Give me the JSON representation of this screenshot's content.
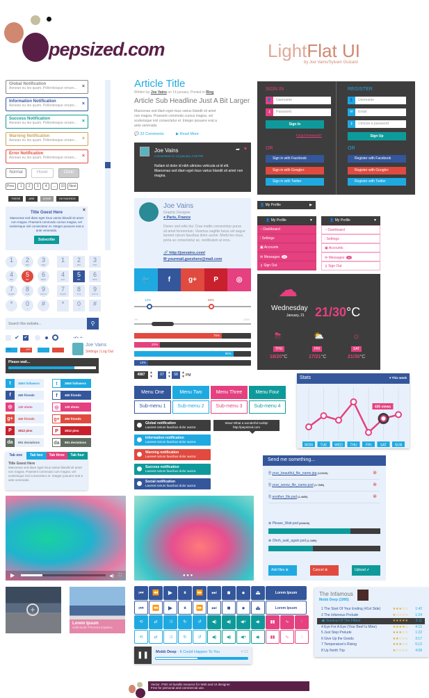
{
  "brand": {
    "logo": "pepsized.com",
    "title_light": "Light",
    "title_flat": "Flat UI",
    "byline": "by Joe Vains/Sylvain Guizard",
    "colors": {
      "plum": "#5a1f47",
      "salmon": "#d08870",
      "sage": "#c5bfa0"
    }
  },
  "notifications": [
    {
      "title": "Global Notification",
      "text": "Aenean eu leo quam. Pellentesque ornare...",
      "color": "#888888"
    },
    {
      "title": "Information Notification",
      "text": "Aenean eu leo quam. Pellentesque ornare...",
      "color": "#34569b"
    },
    {
      "title": "Success Notification",
      "text": "Aenean eu leo quam. Pellentesque ornare...",
      "color": "#0e9a9a"
    },
    {
      "title": "Warning Notification",
      "text": "Aenean eu leo quam. Pellentesque ornare...",
      "color": "#c9a45c"
    },
    {
      "title": "Error Notification",
      "text": "Aenean eu leo quam. Pellentesque ornare...",
      "color": "#e04a3f"
    }
  ],
  "close_glyph": "×",
  "buttons": {
    "normal": "Normal",
    "hover": "Hover",
    "click": "Click!"
  },
  "pagination": [
    "Prev.",
    "1",
    "2",
    "3",
    "4",
    "...",
    "10",
    "Next"
  ],
  "tags": [
    "THESE",
    "ARE",
    "SOME",
    "KEYWORDS"
  ],
  "newsletter": {
    "title": "Title Goest Here",
    "text": "Maecenas sed diam eget risus varius blandit sit amet non magna. Praesent commodo cursus magna, vel scelerisque nisl consectetur et. Integer posuere erat a ante venenatis.",
    "button": "Subscribe"
  },
  "keypad": [
    [
      "1",
      ""
    ],
    [
      "2",
      "ABC"
    ],
    [
      "3",
      "DEF"
    ],
    [
      "4",
      "GHI"
    ],
    [
      "5",
      "JKL"
    ],
    [
      "6",
      "MNO"
    ],
    [
      "7",
      "PQRS"
    ],
    [
      "8",
      "TUV"
    ],
    [
      "9",
      "WXYZ"
    ],
    [
      "*",
      ""
    ],
    [
      "0",
      "+"
    ],
    [
      "#",
      ""
    ]
  ],
  "search": {
    "placeholder": "Search this website..."
  },
  "toggles": {
    "on": "ON",
    "off": "OFF"
  },
  "mini_profile": {
    "name": "Joe Vains",
    "settings": "Settings",
    "logout": "Log Out"
  },
  "please_wait": {
    "label": "Please wait...",
    "progress": 0.75
  },
  "social_counters": [
    {
      "icon": "twitter",
      "glyph": "t",
      "text": "3650 followers",
      "color": "#1fa9e1"
    },
    {
      "icon": "facebook",
      "glyph": "f",
      "text": "450 friends",
      "color": "#34569b"
    },
    {
      "icon": "dribbble",
      "glyph": "◎",
      "text": "120 shots",
      "color": "#e5407f"
    },
    {
      "icon": "google-plus",
      "glyph": "g+",
      "text": "450 friends",
      "color": "#e04a3f"
    },
    {
      "icon": "pinterest",
      "glyph": "P",
      "text": "3812 pins",
      "color": "#c9202e"
    },
    {
      "icon": "deviantart",
      "glyph": "da",
      "text": "951 deviations",
      "color": "#5f6b60"
    }
  ],
  "tabs": {
    "items": [
      "Tab one",
      "Tab two",
      "Tab three",
      "Tab four"
    ],
    "title": "Title Goest Here",
    "text": "Maecenas sed diam eget risus varius blandit sit amet non magna. Praesent commodo curs magna, vel scelerisque nisl consectetur et. Integer posuere erat a ante venenatis."
  },
  "video": {
    "progress": 0.25
  },
  "gallery": {
    "caption_title": "Lorem Ipsum",
    "caption_sub": "Sollicitudin Pharetra Dapibus"
  },
  "article": {
    "title": "Article Title",
    "written_by": "Written by",
    "author": "Joe Vains",
    "on": "on 14 january. Posted in",
    "category": "Blog",
    "subheadline": "Article Sub Headline Just A Bit Larger",
    "body": "Maecenas sed diam eget risus varius blandit sit amet non magna. Praesent commodo cursus magna, vel scelerisque nisl consectetur et. Integer posuere erat a ante venenatis.",
    "comments": "32 Comments",
    "read_more": "Read More"
  },
  "comment": {
    "name": "Joe Vains",
    "meta": "commented on 14 january 4:35 PM",
    "text": "Nullam id dolor id nibh ultricies vehicula ut id elit. Maecenas sed diam eget risus varius blandit sit amet non magna."
  },
  "profile": {
    "name": "Joe Vains",
    "role": "Graphic Designer",
    "location": "Paris, France",
    "bio": "Donec sed odio dui. Cras mattis consectetur purus sit amet fermentum. Vivamus sagittis lacus vel augue laoreet rutrum faucibus dolor auctor. Morbi leo risus, porta ac consectetur ac, vestibulum at eros.",
    "url": "http://joevains.com/",
    "email": "yourmail.goeshere@mail.com"
  },
  "share": [
    {
      "icon": "twitter",
      "glyph": "🐦",
      "color": "#1fa9e1"
    },
    {
      "icon": "facebook",
      "glyph": "f",
      "color": "#34569b"
    },
    {
      "icon": "google-plus",
      "glyph": "g+",
      "color": "#e04a3f"
    },
    {
      "icon": "pinterest",
      "glyph": "P",
      "color": "#c9202e"
    },
    {
      "icon": "dribbble",
      "glyph": "◎",
      "color": "#e5407f"
    }
  ],
  "sliders": {
    "a_label": "12%",
    "a_value": 12,
    "b_label": "69%",
    "b_value": 69,
    "min": "0%",
    "max": "100%",
    "range": [
      10,
      30
    ]
  },
  "progress": [
    {
      "label": "75%",
      "value": 75,
      "color": "#e04a3f"
    },
    {
      "label": "22%",
      "value": 22,
      "color": "#e5407f"
    },
    {
      "label": "85%",
      "value": 85,
      "color": "#1fa9e1"
    },
    {
      "label": "12%",
      "value": 12,
      "color": "#34569b"
    }
  ],
  "steppers": {
    "number": "4987",
    "hour": "07",
    "minute": "58",
    "ampm": "PM"
  },
  "menu": {
    "items": [
      "Menu One",
      "Menu Two",
      "Menu Three",
      "Menu Four"
    ],
    "subs": [
      "Sub-menu 1",
      "Sub-menu 2",
      "Sub-menu 3",
      "Sub-menu 4"
    ]
  },
  "flat_notifs": [
    {
      "title": "Global notification",
      "text": "Laoreet rutrum faucibus dolor auctor.",
      "color": "#3d3d3d"
    },
    {
      "title": "Information notification",
      "text": "Laoreet rutrum faucibus dolor auctor.",
      "color": "#1fa9e1"
    },
    {
      "title": "Warning notification",
      "text": "Laoreet rutrum faucibus dolor auctor.",
      "color": "#e04a3f"
    },
    {
      "title": "Success notification",
      "text": "Laoreet rutrum faucibus dolor auctor.",
      "color": "#0e9a9a"
    },
    {
      "title": "Social notification",
      "text": "Laoreet rutrum faucibus dolor auctor.",
      "color": "#34569b"
    }
  ],
  "tooltip": {
    "line1": "Wow! What a wonderful tooltip!",
    "line2": "http://pepsized.com"
  },
  "signin": {
    "title": "SIGN IN",
    "username": "Username",
    "password": "Password",
    "button": "Sign In",
    "forgot": "Forgot Password?",
    "or": "OR",
    "facebook": "Sign in with Facebook",
    "google": "Sign in with Google+",
    "twitter": "Sign in with Twitter"
  },
  "register": {
    "title": "REGISTER",
    "username": "Username",
    "email": "Email",
    "password": "Choose a password",
    "button": "Sign Up",
    "or": "OR",
    "facebook": "Register with Facebook",
    "google": "Register with Google+",
    "twitter": "Register with Twitter"
  },
  "profile_menu": {
    "label": "My Profile",
    "items": [
      "Dashboard",
      "Settings",
      "Accounts",
      "Messages",
      "Sign Out"
    ],
    "messages_badge": "20"
  },
  "weather": {
    "day": "Wednesday",
    "date": "January, 21",
    "temp": "21/30",
    "unit": "°C",
    "forecast": [
      {
        "day": "THU",
        "temp": "18/20",
        "icon": "rain-sun"
      },
      {
        "day": "FRI",
        "temp": "17/21",
        "icon": "cloud-sun"
      },
      {
        "day": "SAT",
        "temp": "21/30",
        "icon": "sun"
      }
    ]
  },
  "stats": {
    "title": "Stats",
    "filter": "▾ This week",
    "days": [
      "MON",
      "TUE",
      "WED",
      "THU",
      "FRI",
      "SAT",
      "SUN"
    ],
    "relative_values": [
      2,
      4,
      3.2,
      6.5,
      1,
      3.5,
      4.2
    ],
    "tooltip": "435 views",
    "tooltip_day": "SAT"
  },
  "upload": {
    "title": "Send me something...",
    "files": [
      {
        "name": "your_beautiful_file_name.jpg",
        "size": "(123KB)"
      },
      {
        "name": "your_woow_file_name.psd",
        "size": "(1.7MB)"
      },
      {
        "name": "another_file.psd",
        "size": "(2.4MB)"
      }
    ],
    "uploading": [
      {
        "name": "Please_Wait.psd",
        "size": "(800KB)",
        "progress": 0.73
      },
      {
        "name": "Ohoh_wait_again.psd",
        "size": "(2.1MB)",
        "progress": 0.4
      }
    ],
    "add": "Add files",
    "cancel": "Cancel",
    "upload": "Upload"
  },
  "media": {
    "row1": [
      "⏮",
      "⏪",
      "▶",
      "⏸",
      "⏩",
      "⏭",
      "■",
      "●",
      "⏏"
    ],
    "lorem": "Lorem Ipsum",
    "row3": [
      "⟲",
      "⇄",
      "⤨",
      "↻",
      "↺",
      "◀)",
      "◀)",
      "◀+",
      "◀-",
      "▮▮",
      "∿",
      "⫶"
    ]
  },
  "player": {
    "artist": "Mobb Deep",
    "song": "- It Could Happen To You",
    "time": "4:23",
    "progress": 0.97
  },
  "playlist": {
    "album": "The Infamous",
    "artist": "Mobb Deep (1995)",
    "tracks": [
      {
        "n": "1",
        "title": "The Start Of Your Ending (41st Side)",
        "stars": 3,
        "time": "1:42"
      },
      {
        "n": "2",
        "title": "The Infamous Prelude",
        "stars": 1,
        "time": "1:24"
      },
      {
        "n": "3",
        "title": "Survival Of The Fittest",
        "stars": 5,
        "time": "3:11",
        "playing": true
      },
      {
        "n": "4",
        "title": "Eye For A Eye (Your Beef Is Mine)",
        "stars": 4,
        "time": "4:15"
      },
      {
        "n": "5",
        "title": "Just Step Prelude",
        "stars": 3,
        "time": "1:22"
      },
      {
        "n": "6",
        "title": "Give Up the Goods",
        "stars": 2,
        "time": "3:17"
      },
      {
        "n": "7",
        "title": "Temperature's Rising",
        "stars": 3,
        "time": "5:12"
      },
      {
        "n": "8",
        "title": "Up North Trip",
        "stars": 1,
        "time": "4:08"
      }
    ]
  },
  "footer": {
    "line1": "Vector .PSD UI bundle resource for Web and UI designer.",
    "line2": "Free for personal and commercial use."
  }
}
